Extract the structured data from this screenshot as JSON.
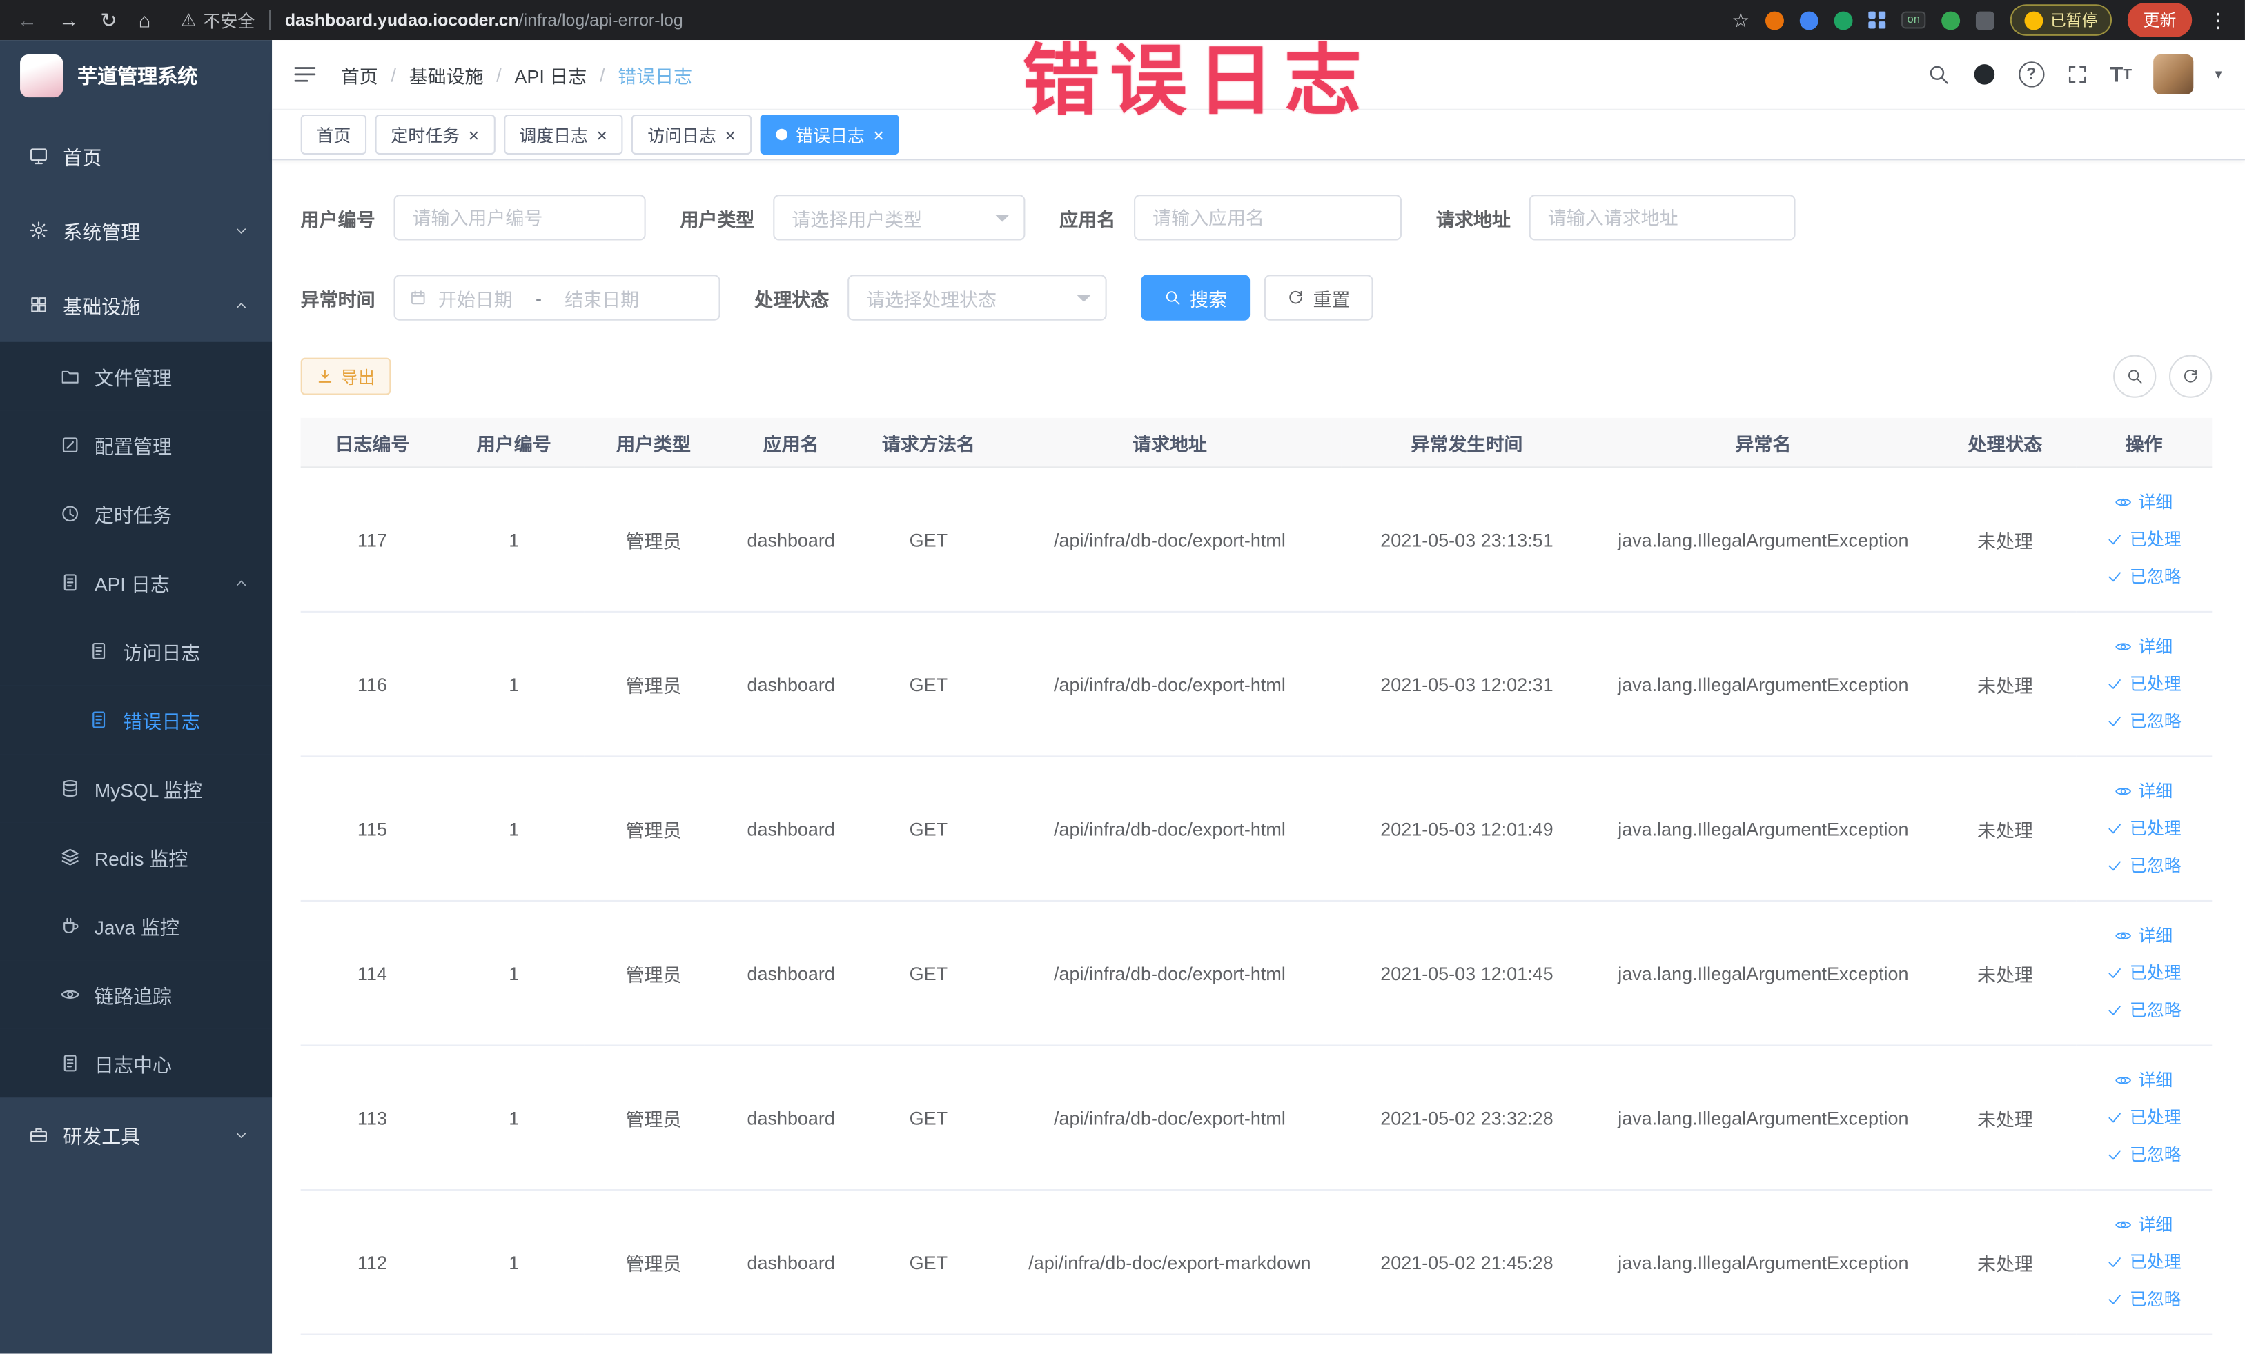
{
  "browser": {
    "security_label": "不安全",
    "url_domain": "dashboard.yudao.iocoder.cn",
    "url_path": "/infra/log/api-error-log",
    "extension_on_badge": "on",
    "paused_badge": "已暂停",
    "update_button": "更新"
  },
  "glyphs": {
    "back": "←",
    "forward": "→",
    "reload": "↻",
    "home": "⌂",
    "warning": "⚠",
    "star": "☆",
    "kebab": "⋮",
    "close": "×",
    "caret_down": "▾",
    "question": "?",
    "font_size": "T"
  },
  "annotation": {
    "text": "错误日志"
  },
  "sidebar": {
    "logo_title": "芋道管理系统",
    "items": [
      {
        "label": "首页"
      },
      {
        "label": "系统管理"
      },
      {
        "label": "基础设施"
      },
      {
        "label": "文件管理"
      },
      {
        "label": "配置管理"
      },
      {
        "label": "定时任务"
      },
      {
        "label": "API 日志"
      },
      {
        "label": "访问日志"
      },
      {
        "label": "错误日志"
      },
      {
        "label": "MySQL 监控"
      },
      {
        "label": "Redis 监控"
      },
      {
        "label": "Java 监控"
      },
      {
        "label": "链路追踪"
      },
      {
        "label": "日志中心"
      },
      {
        "label": "研发工具"
      }
    ]
  },
  "breadcrumb": {
    "separator": "/",
    "items": [
      "首页",
      "基础设施",
      "API 日志",
      "错误日志"
    ]
  },
  "tabs": [
    {
      "label": "首页"
    },
    {
      "label": "定时任务"
    },
    {
      "label": "调度日志"
    },
    {
      "label": "访问日志"
    },
    {
      "label": "错误日志"
    }
  ],
  "filters": {
    "user_id_label": "用户编号",
    "user_id_placeholder": "请输入用户编号",
    "user_type_label": "用户类型",
    "user_type_placeholder": "请选择用户类型",
    "app_name_label": "应用名",
    "app_name_placeholder": "请输入应用名",
    "request_url_label": "请求地址",
    "request_url_placeholder": "请输入请求地址",
    "exception_time_label": "异常时间",
    "date_start_placeholder": "开始日期",
    "date_separator": "-",
    "date_end_placeholder": "结束日期",
    "process_status_label": "处理状态",
    "process_status_placeholder": "请选择处理状态",
    "search_button": "搜索",
    "reset_button": "重置"
  },
  "toolbar": {
    "export_button": "导出"
  },
  "table": {
    "columns": [
      "日志编号",
      "用户编号",
      "用户类型",
      "应用名",
      "请求方法名",
      "请求地址",
      "异常发生时间",
      "异常名",
      "处理状态",
      "操作"
    ],
    "actions": {
      "detail": "详细",
      "processed": "已处理",
      "ignored": "已忽略"
    },
    "rows": [
      {
        "log_id": "117",
        "user_id": "1",
        "user_type": "管理员",
        "app_name": "dashboard",
        "method": "GET",
        "request_url": "/api/infra/db-doc/export-html",
        "time": "2021-05-03 23:13:51",
        "exception": "java.lang.IllegalArgumentException",
        "status": "未处理"
      },
      {
        "log_id": "116",
        "user_id": "1",
        "user_type": "管理员",
        "app_name": "dashboard",
        "method": "GET",
        "request_url": "/api/infra/db-doc/export-html",
        "time": "2021-05-03 12:02:31",
        "exception": "java.lang.IllegalArgumentException",
        "status": "未处理"
      },
      {
        "log_id": "115",
        "user_id": "1",
        "user_type": "管理员",
        "app_name": "dashboard",
        "method": "GET",
        "request_url": "/api/infra/db-doc/export-html",
        "time": "2021-05-03 12:01:49",
        "exception": "java.lang.IllegalArgumentException",
        "status": "未处理"
      },
      {
        "log_id": "114",
        "user_id": "1",
        "user_type": "管理员",
        "app_name": "dashboard",
        "method": "GET",
        "request_url": "/api/infra/db-doc/export-html",
        "time": "2021-05-03 12:01:45",
        "exception": "java.lang.IllegalArgumentException",
        "status": "未处理"
      },
      {
        "log_id": "113",
        "user_id": "1",
        "user_type": "管理员",
        "app_name": "dashboard",
        "method": "GET",
        "request_url": "/api/infra/db-doc/export-html",
        "time": "2021-05-02 23:32:28",
        "exception": "java.lang.IllegalArgumentException",
        "status": "未处理"
      },
      {
        "log_id": "112",
        "user_id": "1",
        "user_type": "管理员",
        "app_name": "dashboard",
        "method": "GET",
        "request_url": "/api/infra/db-doc/export-markdown",
        "time": "2021-05-02 21:45:28",
        "exception": "java.lang.IllegalArgumentException",
        "status": "未处理"
      }
    ]
  },
  "colors": {
    "primary": "#409eff",
    "warning": "#e6a23c",
    "annotation": "#ee3f5e",
    "sidebar_bg": "#304156",
    "sidebar_submenu_bg": "#1f2d3d"
  }
}
